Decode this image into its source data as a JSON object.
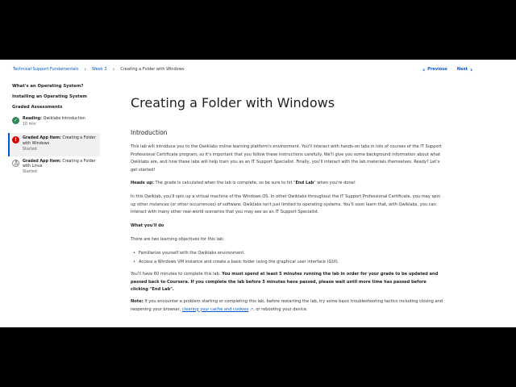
{
  "breadcrumb": {
    "course": "Technical Support Fundamentals",
    "week": "Week 3",
    "current": "Creating a Folder with Windows"
  },
  "pager": {
    "previous": "Previous",
    "next": "Next"
  },
  "sidebar": {
    "modules": [
      "What's an Operating System?",
      "Installing an Operating System",
      "Graded Assessments"
    ],
    "items": [
      {
        "type": "Reading:",
        "title": "Qwiklabs Introduction",
        "meta": "10 min",
        "status": "completed"
      },
      {
        "type": "Graded App Item:",
        "title": "Creating a Folder with Windows",
        "meta": "Started",
        "status": "active"
      },
      {
        "type": "Graded App Item:",
        "title": "Creating a Folder with Linux",
        "meta": "Started",
        "status": "started"
      }
    ]
  },
  "content": {
    "title": "Creating a Folder with Windows",
    "section": "Introduction",
    "intro": "This lab will introduce you to the Qwiklabs online learning platform's environment. You'll interact with hands-on labs in lots of courses of the IT Support Professional Certificate program, so it's important that you follow these instructions carefully. We'll give you some background information about what Qwiklabs are, and how these labs will help train you as an IT Support Specialist. Finally, you'll interact with the lab materials themselves. Ready? Let's get started!",
    "headsup_label": "Heads up:",
    "headsup_text_a": " The grade is calculated when the lab is complete, so be sure to hit \"",
    "headsup_bold": "End Lab",
    "headsup_text_b": "\" when you're done!",
    "para2_a": "In this Qwiklab, you'll spin up a virtual machine of the Windows OS. In other Qwiklabs throughout the IT Support Professional Certificate, you may spin up other ",
    "para2_em": "instances",
    "para2_b": " (or other occurrences) of software; Qwiklabs isn't just limited to operating systems. You'll soon learn that, with Qwiklabs, you can interact with many other real-world scenarios that you may see as an IT Support Specialist.",
    "wyd": "What you'll do",
    "objectives_intro": "There are two learning objectives for this lab:",
    "objectives": [
      "Familiarize yourself with the Qwiklabs environment.",
      "Access a Windows VM instance and create a basic folder using the graphical user interface (GUI)."
    ],
    "time_a": "You'll have 60 minutes to complete this lab. ",
    "time_bold": "You must spend at least 5 minutes running the lab in order for your grade to be updated and passed back to Coursera. If you complete the lab before 5 minutes have passed, please wait until more time has passed before clicking \"End Lab\".",
    "note_label": "Note:",
    "note_a": " If you encounter a problem starting or completing this lab, before restarting the lab, try some basic troubleshooting tactics including closing and reopening your browser, ",
    "note_link": "clearing your cache and cookies",
    "note_b": ", or rebooting your device."
  }
}
